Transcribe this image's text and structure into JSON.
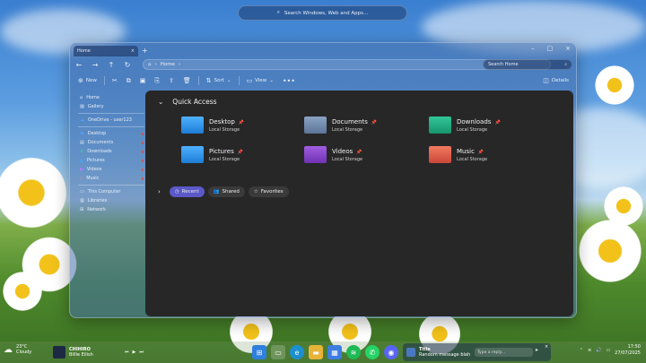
{
  "search_bar": {
    "placeholder": "Search Windows, Web and Apps..."
  },
  "window": {
    "tab_title": "Home",
    "nav": {
      "address": "Home",
      "search_placeholder": "Search Home"
    },
    "toolbar": {
      "new": "New",
      "sort": "Sort",
      "view": "View",
      "details": "Details"
    },
    "sidebar": {
      "top": [
        {
          "label": "Home",
          "icon": "home-icon"
        },
        {
          "label": "Gallery",
          "icon": "gallery-icon"
        }
      ],
      "onedrive": "OneDrive - user123",
      "pinned": [
        {
          "label": "Desktop"
        },
        {
          "label": "Documents"
        },
        {
          "label": "Downloads"
        },
        {
          "label": "Pictures"
        },
        {
          "label": "Videos"
        },
        {
          "label": "Music"
        }
      ],
      "bottom": [
        {
          "label": "This Computer"
        },
        {
          "label": "Libraries"
        },
        {
          "label": "Network"
        }
      ]
    },
    "quick_access": {
      "title": "Quick Access",
      "folders": [
        {
          "name": "Desktop",
          "sub": "Local Storage",
          "color": "#2b8fe0"
        },
        {
          "name": "Documents",
          "sub": "Local Storage",
          "color": "#6f8ab0"
        },
        {
          "name": "Downloads",
          "sub": "Local Storage",
          "color": "#1ea77f"
        },
        {
          "name": "Pictures",
          "sub": "Local Storage",
          "color": "#2e8fd8"
        },
        {
          "name": "Videos",
          "sub": "Local Storage",
          "color": "#8a3fc9"
        },
        {
          "name": "Music",
          "sub": "Local Storage",
          "color": "#e0624a"
        }
      ]
    },
    "chips": [
      {
        "label": "Recent",
        "active": true
      },
      {
        "label": "Shared"
      },
      {
        "label": "Favorites"
      }
    ]
  },
  "taskbar": {
    "weather": {
      "temp": "23°C",
      "cond": "Cloudy"
    },
    "media": {
      "title": "CHIHIRO",
      "artist": "Billie Eilish"
    },
    "notification": {
      "title": "Title",
      "message": "Random message blah",
      "reply_placeholder": "Type a reply..."
    },
    "clock": {
      "time": "17:50",
      "date": "27/07/2025"
    }
  }
}
